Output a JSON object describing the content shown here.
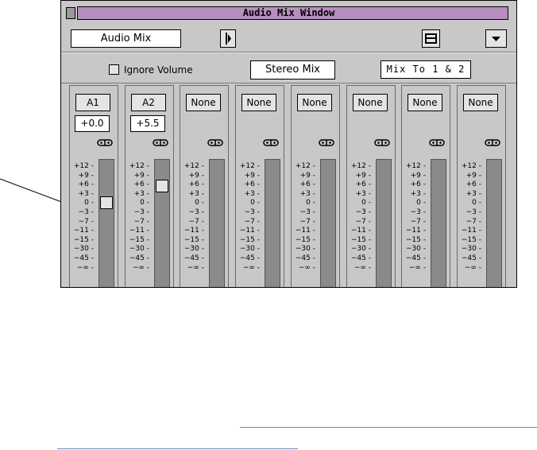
{
  "window": {
    "title": "Audio Mix Window"
  },
  "toolbar": {
    "mix_name": "Audio Mix",
    "play_icon": "play-icon",
    "menu_icon": "menu-icon",
    "dropdown_icon": "triangle-down-icon"
  },
  "options": {
    "ignore_volume_label": "Ignore Volume",
    "ignore_volume_checked": false,
    "stereo_mix_label": "Stereo Mix",
    "mix_to_label": "Mix To 1 & 2"
  },
  "scale_labels": [
    "+12",
    "+9",
    "+6",
    "+3",
    "0",
    "−3",
    "−7",
    "−11",
    "−15",
    "−30",
    "−45",
    "−∞"
  ],
  "channels": [
    {
      "name": "A1",
      "value": "+0.0",
      "level_db": 0.0
    },
    {
      "name": "A2",
      "value": "+5.5",
      "level_db": 5.5
    },
    {
      "name": "None"
    },
    {
      "name": "None"
    },
    {
      "name": "None"
    },
    {
      "name": "None"
    },
    {
      "name": "None"
    },
    {
      "name": "None"
    }
  ]
}
